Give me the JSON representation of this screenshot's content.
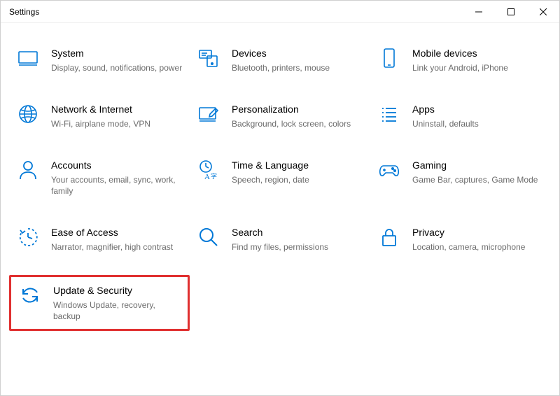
{
  "window": {
    "title": "Settings"
  },
  "categories": [
    {
      "id": "system",
      "title": "System",
      "desc": "Display, sound, notifications, power"
    },
    {
      "id": "devices",
      "title": "Devices",
      "desc": "Bluetooth, printers, mouse"
    },
    {
      "id": "mobile",
      "title": "Mobile devices",
      "desc": "Link your Android, iPhone"
    },
    {
      "id": "network",
      "title": "Network & Internet",
      "desc": "Wi-Fi, airplane mode, VPN"
    },
    {
      "id": "personalization",
      "title": "Personalization",
      "desc": "Background, lock screen, colors"
    },
    {
      "id": "apps",
      "title": "Apps",
      "desc": "Uninstall, defaults"
    },
    {
      "id": "accounts",
      "title": "Accounts",
      "desc": "Your accounts, email, sync, work, family"
    },
    {
      "id": "time",
      "title": "Time & Language",
      "desc": "Speech, region, date"
    },
    {
      "id": "gaming",
      "title": "Gaming",
      "desc": "Game Bar, captures, Game Mode"
    },
    {
      "id": "ease",
      "title": "Ease of Access",
      "desc": "Narrator, magnifier, high contrast"
    },
    {
      "id": "search",
      "title": "Search",
      "desc": "Find my files, permissions"
    },
    {
      "id": "privacy",
      "title": "Privacy",
      "desc": "Location, camera, microphone"
    },
    {
      "id": "update",
      "title": "Update & Security",
      "desc": "Windows Update, recovery, backup",
      "highlight": true
    }
  ]
}
